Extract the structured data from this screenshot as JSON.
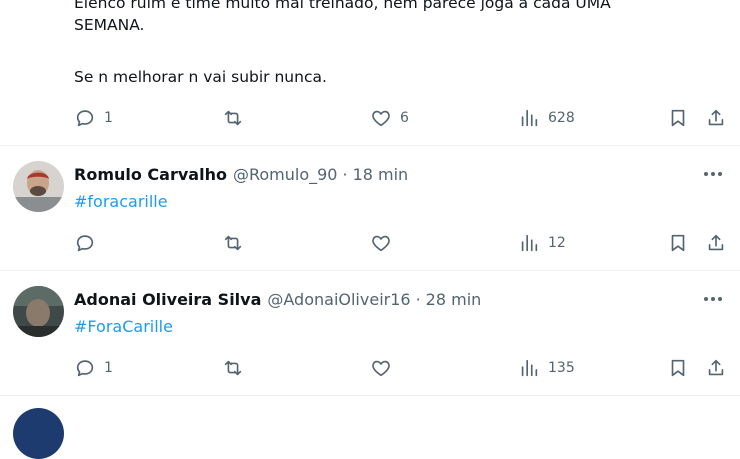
{
  "tweet1": {
    "text_partial": "Elenco ruim e time muito mal treinado, nem parece joga a cada UMA\nSEMANA.",
    "text_line2": "Se n melhorar n vai subir nunca.",
    "replies": "1",
    "retweets": "",
    "likes": "6",
    "views": "628"
  },
  "tweet2": {
    "name": "Romulo Carvalho",
    "handle": "@Romulo_90",
    "separator": "·",
    "time": "18 min",
    "hashtag": "#foracarille",
    "replies": "",
    "retweets": "",
    "likes": "",
    "views": "12"
  },
  "tweet3": {
    "name": "Adonai Oliveira Silva",
    "handle": "@AdonaiOliveir16",
    "separator": "·",
    "time": "28 min",
    "hashtag": "#ForaCarille",
    "replies": "1",
    "retweets": "",
    "likes": "",
    "views": "135"
  },
  "colors": {
    "accent": "#1d9bf0",
    "muted": "#536471",
    "text": "#0f1419"
  }
}
